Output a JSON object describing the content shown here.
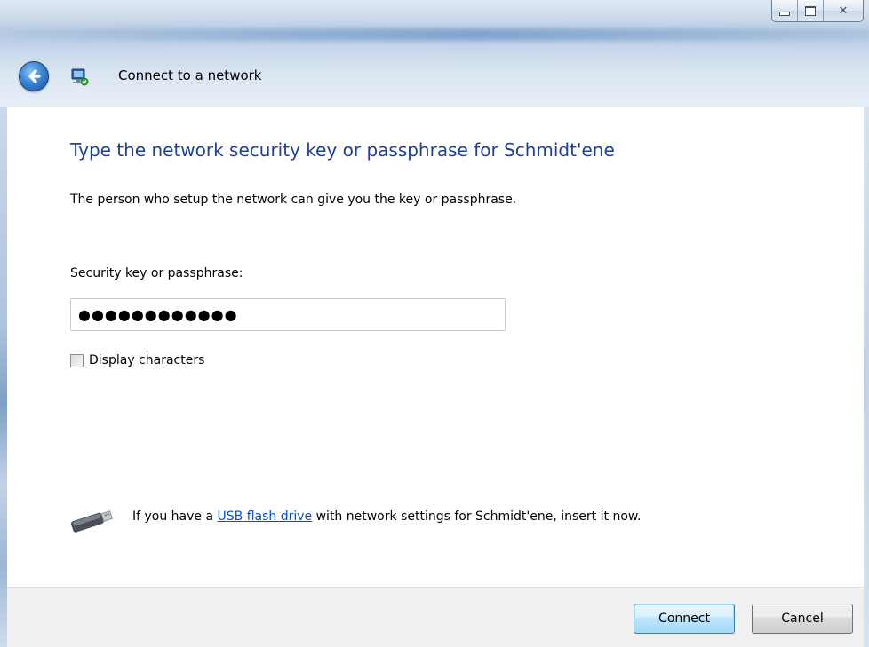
{
  "window": {
    "title": "Connect to a network",
    "caption_buttons": {
      "minimize_icon": "minimize-icon",
      "maximize_icon": "maximize-icon",
      "close_icon": "close-icon"
    }
  },
  "nav": {
    "back_icon": "back-arrow-icon",
    "network_icon": "network-icon"
  },
  "main": {
    "heading": "Type the network security key or passphrase for Schmidt'ene",
    "description": "The person who setup the network can give you the key or passphrase.",
    "key_field": {
      "label": "Security key or passphrase:",
      "value": "●●●●●●●●●●●●"
    },
    "display_characters": {
      "label": "Display characters",
      "checked": false
    },
    "usb_hint": {
      "icon": "usb-drive-icon",
      "prefix": "If you have a ",
      "link": "USB flash drive",
      "suffix": " with network settings for Schmidt'ene, insert it now."
    }
  },
  "footer": {
    "connect_label": "Connect",
    "cancel_label": "Cancel"
  },
  "colors": {
    "heading": "#1e3f9a",
    "link": "#0b51c5",
    "footer_bg": "#f0f0f0"
  }
}
